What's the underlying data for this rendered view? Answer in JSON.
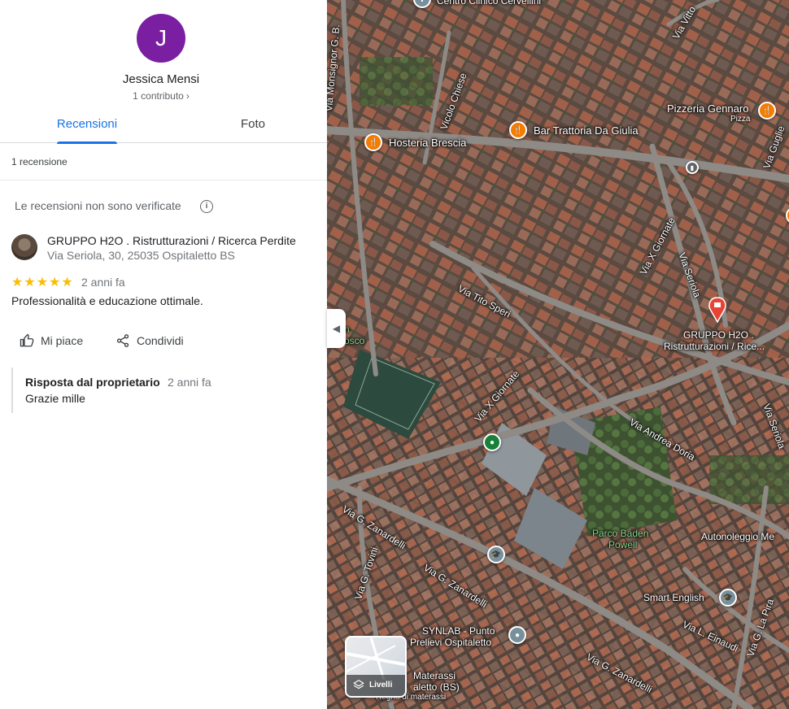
{
  "profile": {
    "initial": "J",
    "avatar_color": "#7b1fa2",
    "name": "Jessica Mensi",
    "contributions": "1 contributo",
    "chevron": "›"
  },
  "tabs": {
    "reviews": "Recensioni",
    "photos": "Foto",
    "active": "reviews",
    "active_color": "#1a73e8"
  },
  "reviews_count": "1 recensione",
  "notice": {
    "text": "Le recensioni non sono verificate",
    "icon": "info-icon"
  },
  "review": {
    "business_name": "GRUPPO H2O . Ristrutturazioni / Ricerca Perdite",
    "business_address": "Via Seriola, 30, 25035 Ospitaletto BS",
    "stars": "★★★★★",
    "rating": 5,
    "date": "2 anni fa",
    "text": "Professionalità e educazione ottimale.",
    "like_label": "Mi piace",
    "share_label": "Condividi",
    "owner_reply": {
      "title": "Risposta dal proprietario",
      "date": "2 anni fa",
      "text": "Grazie mille"
    }
  },
  "map": {
    "collapse_icon": "◀",
    "layers_label": "Livelli",
    "places": {
      "centro": "Centro Clinico Cervellini",
      "pizzeria": "Pizzeria Gennaro",
      "pizzeria_sub": "Pizza",
      "trattoria": "Bar Trattoria Da Giulia",
      "hosteria": "Hosteria Brescia",
      "gruppo1": "GRUPPO H2O .",
      "gruppo2": "Ristrutturazioni / Rice...",
      "parco1": "Parco Baden",
      "parco2": "Powell",
      "autonoleggio": "Autonoleggio Me",
      "smart": "Smart English",
      "synlab1": "SYNLAB - Punto",
      "synlab2": "Prelievi Ospitaletto",
      "materassi1": "Materassi",
      "materassi2": "aletto (BS)",
      "materassi3": "Regno di materassi",
      "oratorio1": "n",
      "oratorio2": "osco"
    },
    "roads": {
      "monsignor": "Via Monsignor G. B.",
      "vicolo": "Vicolo Chiese",
      "vittorio": "Via Vitto",
      "tito": "Via Tito Speri",
      "x_giornate_1": "Via X Giornate",
      "x_giornate_2": "Via X Giornate",
      "seriola_1": "Via Seriola",
      "seriola_2": "Via Seriola",
      "andrea": "Via Andrea Doria",
      "zanardelli_1": "Via G. Zanardelli",
      "zanardelli_2": "Via G. Zanardelli",
      "zanardelli_3": "Via G. Zanardelli",
      "tovini": "Via G. Tovini",
      "einaudi": "Via L. Einaudi",
      "lapira": "Via G. La Pira",
      "guglielmi": "Via Guglie"
    }
  }
}
